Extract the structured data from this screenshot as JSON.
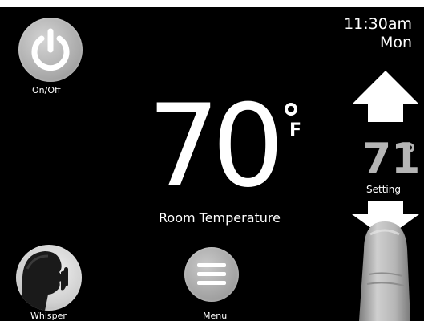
{
  "status": {
    "time": "11:30am",
    "day": "Mon"
  },
  "controls": {
    "power_label": "On/Off",
    "whisper_label": "Whisper",
    "menu_label": "Menu"
  },
  "room": {
    "temperature": "70",
    "unit": "F",
    "caption": "Room Temperature"
  },
  "setpoint": {
    "value": "71",
    "label": "Setting"
  },
  "icons": {
    "power": "power-icon",
    "whisper": "whisper-face-icon",
    "menu": "hamburger-menu-icon",
    "up": "up-arrow-icon",
    "down": "down-arrow-icon"
  },
  "colors": {
    "background": "#000000",
    "text": "#ffffff",
    "setpoint": "#b5b5b5",
    "button": "#a9a9a9"
  }
}
